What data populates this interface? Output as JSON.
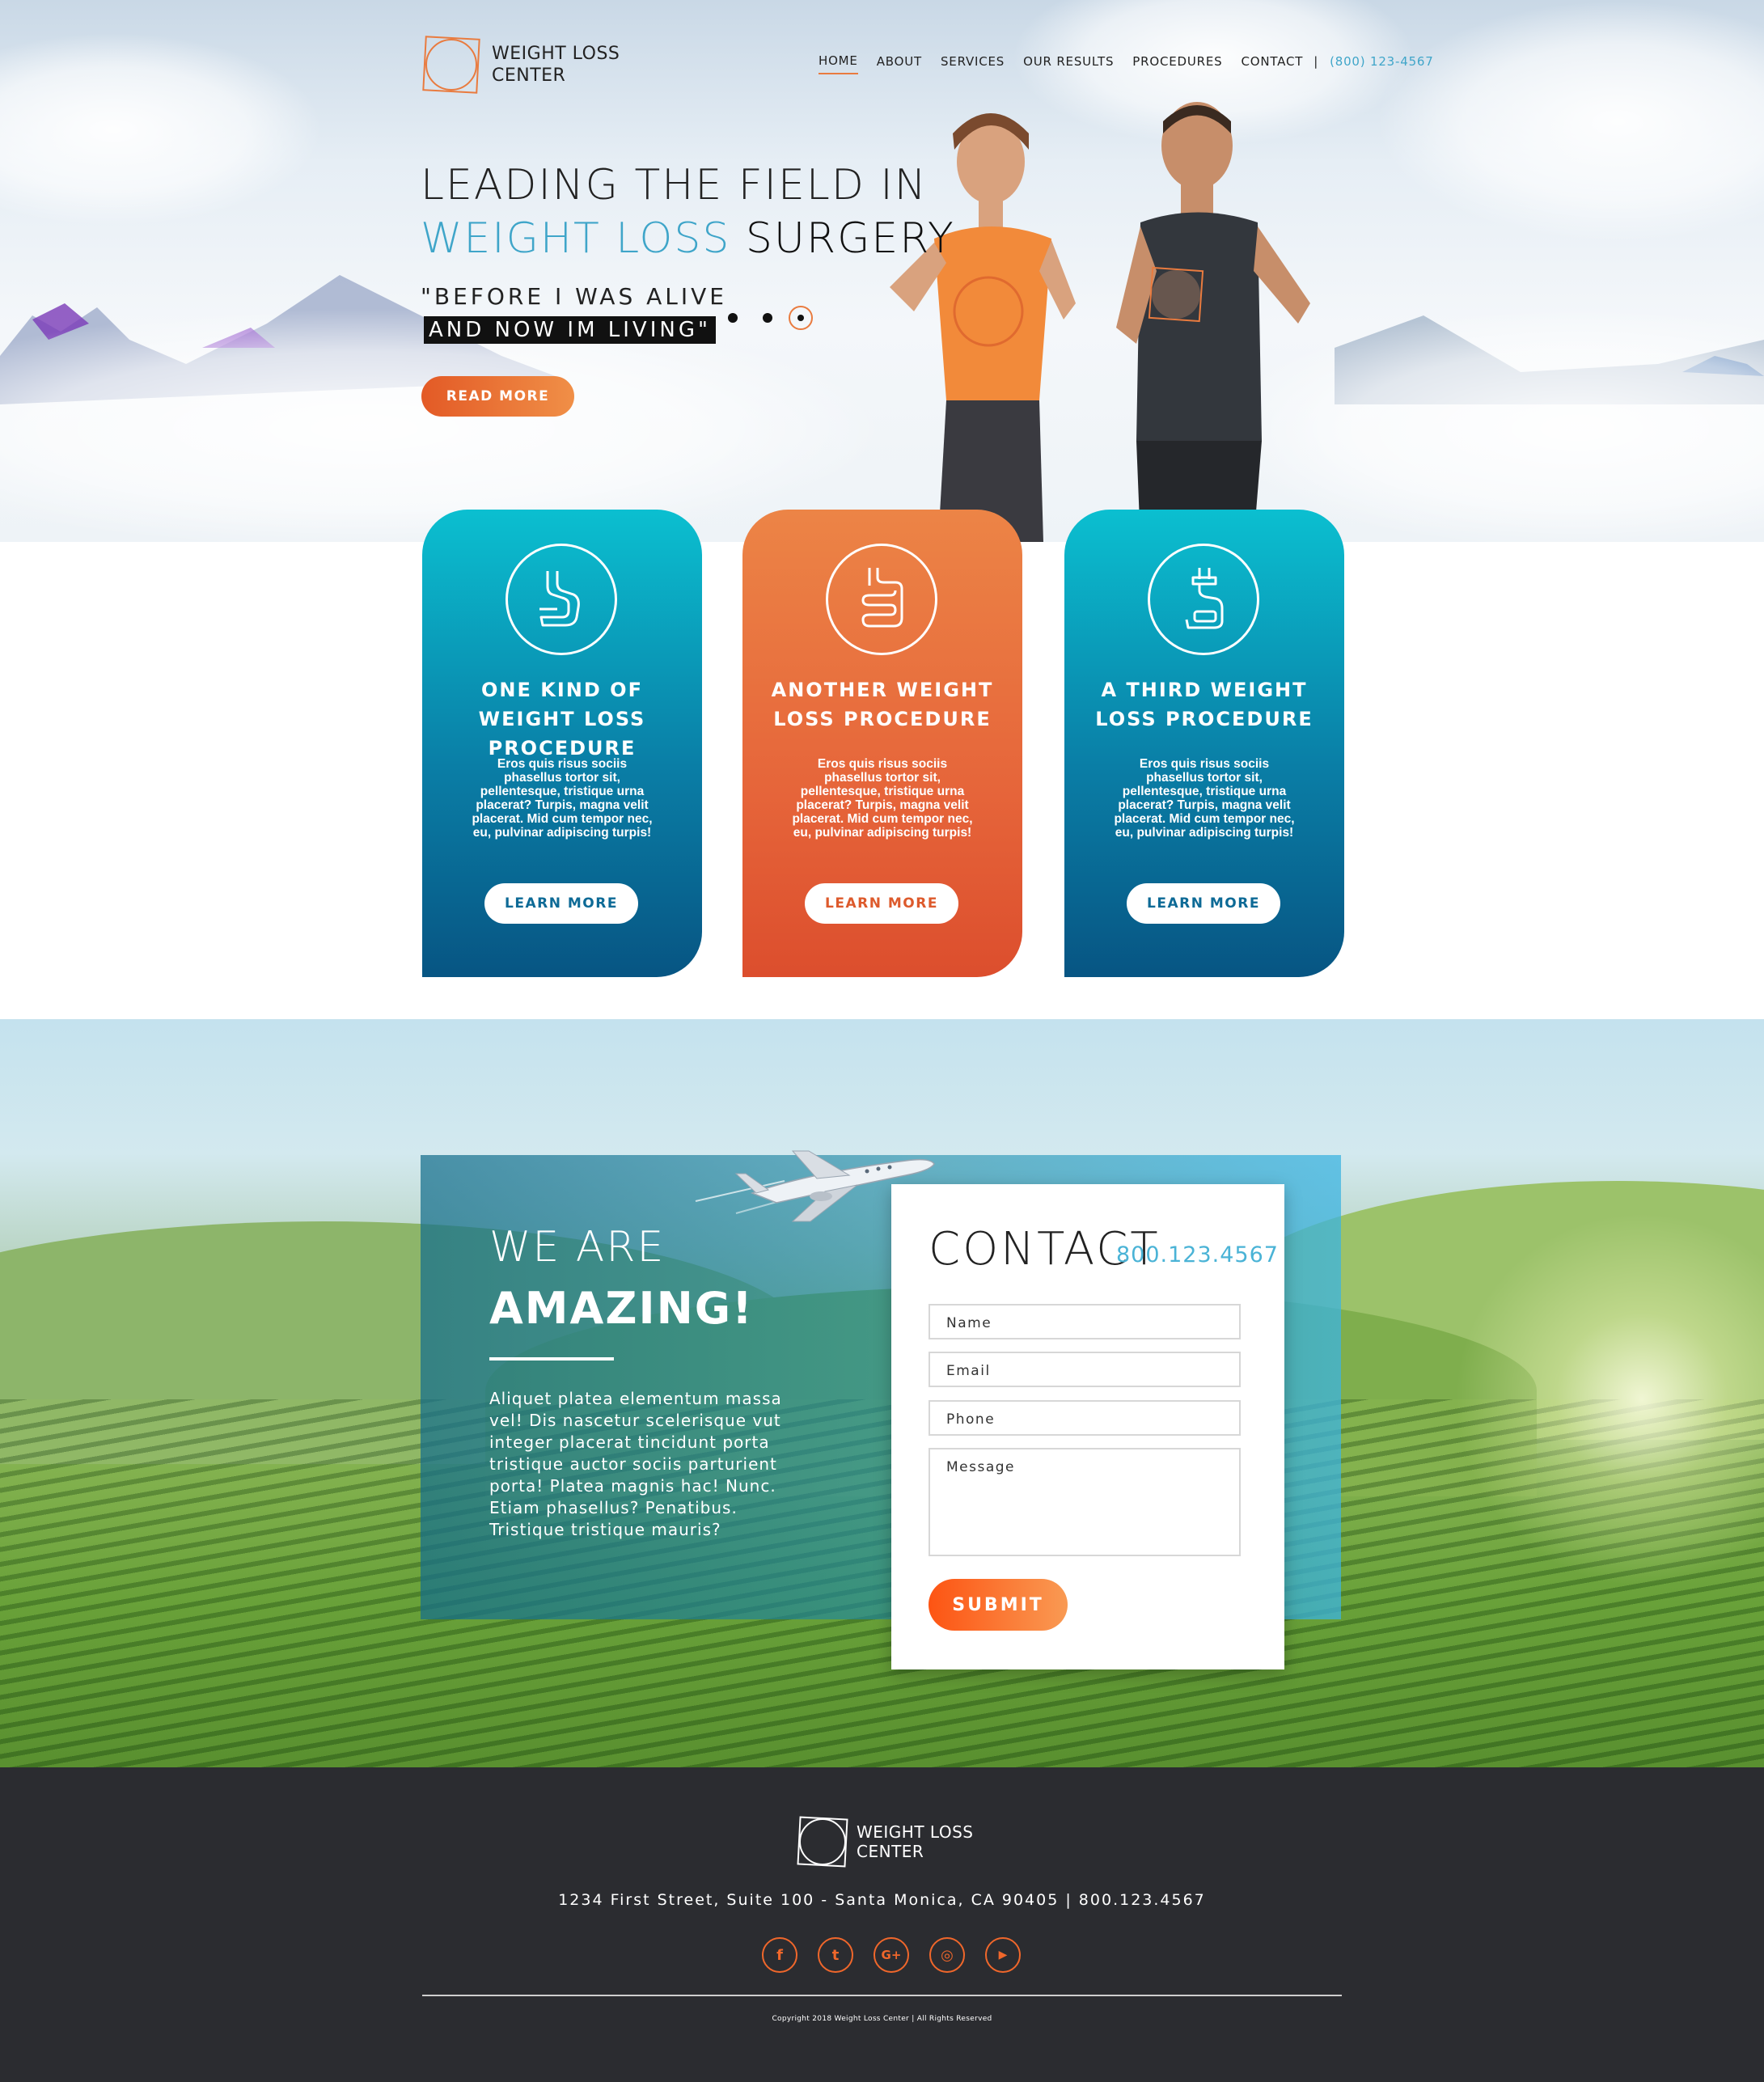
{
  "brand": {
    "name_line1": "WEIGHT LOSS",
    "name_line2": "CENTER",
    "accent": "#e97b3f",
    "blue": "#3fa5c9"
  },
  "nav": {
    "items": [
      {
        "label": "HOME",
        "active": true
      },
      {
        "label": "ABOUT"
      },
      {
        "label": "SERVICES"
      },
      {
        "label": "OUR RESULTS"
      },
      {
        "label": "PROCEDURES"
      },
      {
        "label": "CONTACT"
      }
    ],
    "separator": "|",
    "phone": "(800) 123-4567"
  },
  "hero": {
    "line1": "LEADING THE FIELD IN",
    "line2_blue": "WEIGHT LOSS",
    "line2_dark": "SURGERY",
    "quote_line1": "\"BEFORE I WAS ALIVE",
    "quote_line2": "AND NOW IM LIVING\"",
    "cta": "READ MORE",
    "slides": {
      "count": 3,
      "active": 3
    }
  },
  "cards": [
    {
      "title": "ONE KIND OF WEIGHT LOSS PROCEDURE",
      "body": "Eros quis risus sociis phasellus tortor sit, pellentesque, tristique urna placerat? Turpis, magna velit placerat. Mid cum tempor nec, eu, pulvinar adipiscing turpis!",
      "button": "LEARN MORE",
      "icon": "stomach-icon",
      "color": "#0a7ea6"
    },
    {
      "title": "ANOTHER WEIGHT LOSS PROCEDURE",
      "body": "Eros quis risus sociis phasellus tortor sit, pellentesque, tristique urna placerat? Turpis, magna velit placerat. Mid cum tempor nec, eu, pulvinar adipiscing turpis!",
      "button": "LEARN MORE",
      "icon": "intestine-icon",
      "color": "#e6653a"
    },
    {
      "title": "A THIRD WEIGHT LOSS PROCEDURE",
      "body": "Eros quis risus sociis phasellus tortor sit, pellentesque, tristique urna placerat? Turpis, magna velit placerat. Mid cum tempor nec, eu, pulvinar adipiscing turpis!",
      "button": "LEARN MORE",
      "icon": "gastric-band-icon",
      "color": "#0a7ea6"
    }
  ],
  "about": {
    "heading_light": "WE ARE",
    "heading_bold": "AMAZING!",
    "body": "Aliquet platea elementum massa vel! Dis nascetur scelerisque vut integer placerat tincidunt porta tristique auctor sociis parturient porta! Platea magnis hac! Nunc. Etiam phasellus? Penatibus. Tristique tristique mauris?"
  },
  "contact": {
    "title": "CONTACT",
    "phone": "800.123.4567",
    "fields": {
      "name": "Name",
      "email": "Email",
      "phone": "Phone",
      "message": "Message"
    },
    "submit": "SUBMIT"
  },
  "footer": {
    "address": "1234 First Street, Suite 100 - Santa Monica, CA 90405  |  800.123.4567",
    "socials": [
      {
        "icon": "facebook-icon",
        "glyph": "f"
      },
      {
        "icon": "twitter-icon",
        "glyph": "t"
      },
      {
        "icon": "google-plus-icon",
        "glyph": "G+"
      },
      {
        "icon": "instagram-icon",
        "glyph": "◎"
      },
      {
        "icon": "youtube-icon",
        "glyph": "▶"
      }
    ],
    "copyright": "Copyright 2018 Weight Loss Center  |  All Rights Reserved"
  }
}
